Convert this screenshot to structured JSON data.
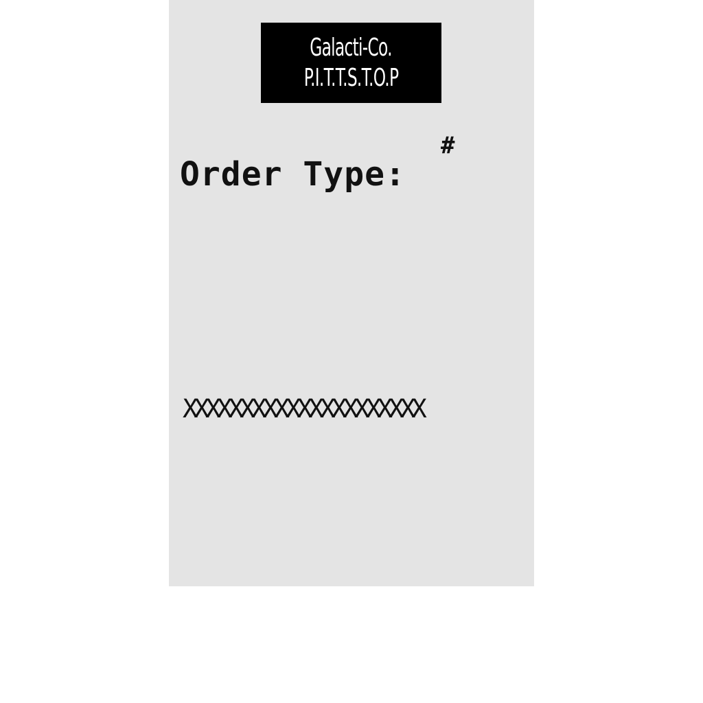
{
  "receipt": {
    "logo": {
      "line1": "Galacti-Co.",
      "line2": "P.I.T.T.S.T.O.P"
    },
    "order_number_symbol": "#",
    "order_type_label": "Order Type:",
    "divider": "XXXXXXXXXXXXXXXXXXXXX"
  },
  "colors": {
    "paper": "#e4e4e4",
    "logo_background": "#000000",
    "logo_text": "#ffffff",
    "ink": "#111111"
  }
}
